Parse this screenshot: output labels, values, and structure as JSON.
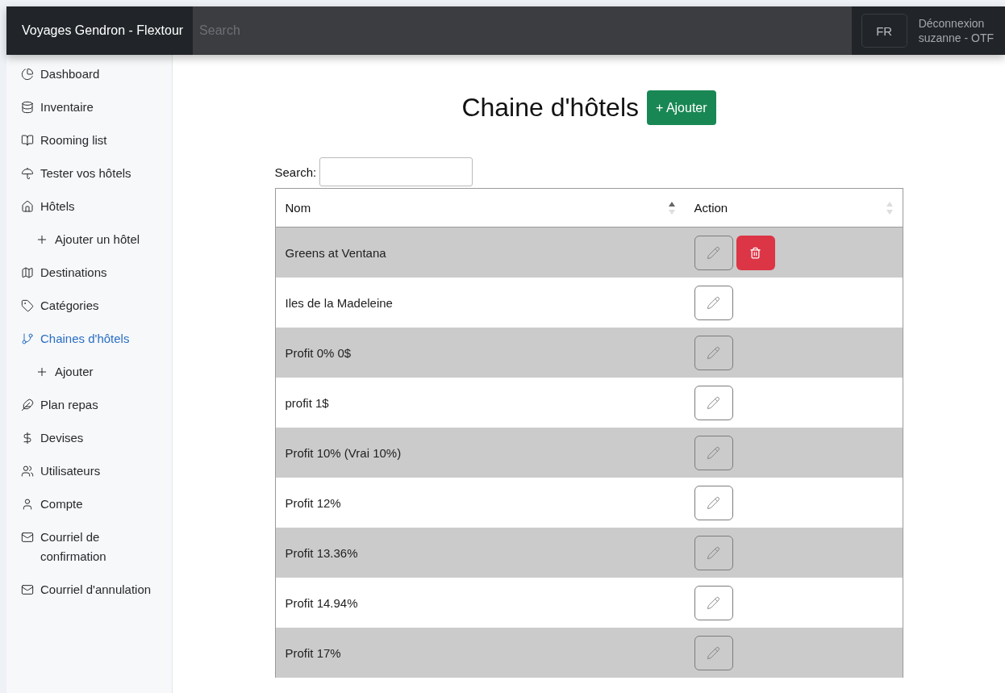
{
  "navbar": {
    "brand": "Voyages Gendron - Flextour",
    "search": {
      "placeholder": "Search"
    },
    "language_button": "FR",
    "logout_link": "Déconnexion",
    "user": "suzanne - OTF"
  },
  "sidebar": {
    "items": [
      {
        "label": "Dashboard",
        "selected": false
      },
      {
        "label": "Inventaire",
        "selected": false
      },
      {
        "label": "Rooming list",
        "selected": false
      },
      {
        "label": "Tester vos hôtels",
        "selected": false
      },
      {
        "label": "Hôtels",
        "selected": false,
        "children": [
          {
            "label": "Ajouter un hôtel",
            "selected": false
          }
        ]
      },
      {
        "label": "Destinations",
        "selected": false
      },
      {
        "label": "Catégories",
        "selected": false
      },
      {
        "label": "Chaines d'hôtels",
        "selected": true,
        "children": [
          {
            "label": "Ajouter",
            "selected": false
          }
        ]
      },
      {
        "label": "Plan repas",
        "selected": false
      },
      {
        "label": "Devises",
        "selected": false
      },
      {
        "label": "Utilisateurs",
        "selected": false
      },
      {
        "label": "Compte",
        "selected": false
      },
      {
        "label": "Courriel de confirmation",
        "selected": false
      },
      {
        "label": "Courriel d'annulation",
        "selected": false
      }
    ]
  },
  "page": {
    "title": "Chaine d'hôtels",
    "add_button": "+ Ajouter"
  },
  "table": {
    "search_label": "Search:",
    "columns": [
      {
        "label": "Nom",
        "sorted": true
      },
      {
        "label": "Action",
        "sorted": false
      }
    ],
    "rows": [
      {
        "name": "Greens at Ventana",
        "hovered": true
      },
      {
        "name": "Iles de la Madeleine",
        "hovered": false
      },
      {
        "name": "Profit 0% 0$",
        "hovered": false
      },
      {
        "name": "profit 1$",
        "hovered": false
      },
      {
        "name": "Profit 10% (Vrai 10%)",
        "hovered": false
      },
      {
        "name": "Profit 12%",
        "hovered": false
      },
      {
        "name": "Profit 13.36%",
        "hovered": false
      },
      {
        "name": "Profit 14.94%",
        "hovered": false
      },
      {
        "name": "Profit 17%",
        "hovered": false
      }
    ]
  }
}
